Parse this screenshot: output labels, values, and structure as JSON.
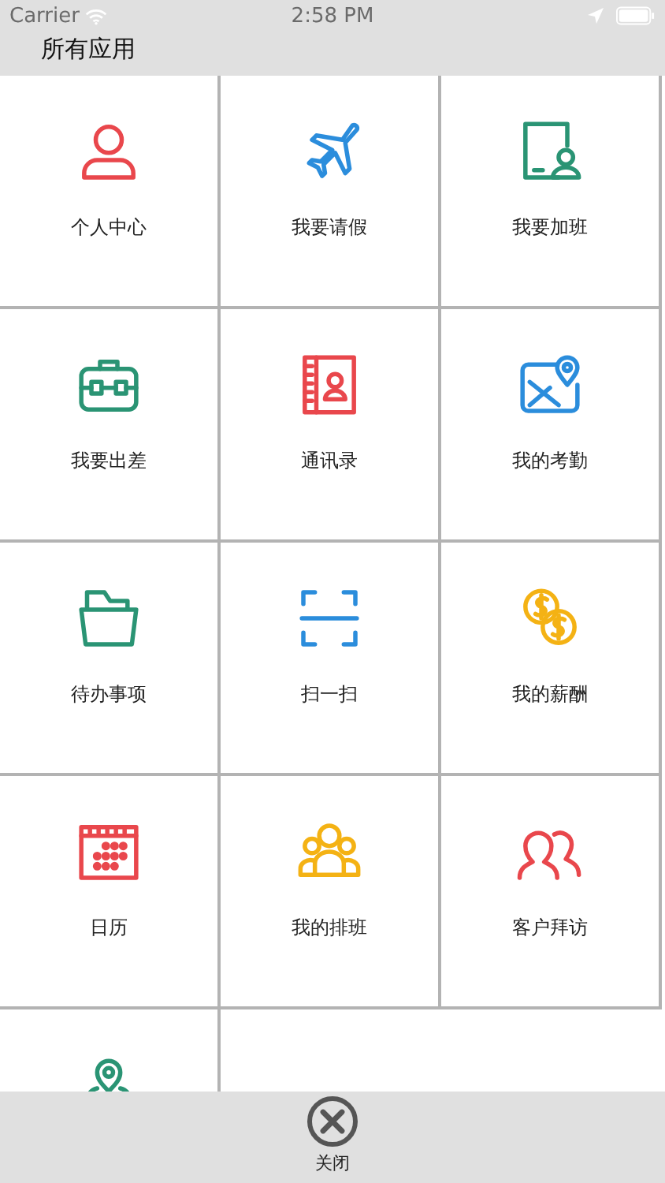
{
  "status_bar": {
    "carrier": "Carrier",
    "time": "2:58 PM"
  },
  "title": "所有应用",
  "apps": [
    {
      "label": "个人中心",
      "color": "#e9474c"
    },
    {
      "label": "我要请假",
      "color": "#2b8ddc"
    },
    {
      "label": "我要加班",
      "color": "#2a9474"
    },
    {
      "label": "我要出差",
      "color": "#2a9474"
    },
    {
      "label": "通讯录",
      "color": "#e9474c"
    },
    {
      "label": "我的考勤",
      "color": "#2b8ddc"
    },
    {
      "label": "待办事项",
      "color": "#2a9474"
    },
    {
      "label": "扫一扫",
      "color": "#2b8ddc"
    },
    {
      "label": "我的薪酬",
      "color": "#f4b214"
    },
    {
      "label": "日历",
      "color": "#e9474c"
    },
    {
      "label": "我的排班",
      "color": "#f4b214"
    },
    {
      "label": "客户拜访",
      "color": "#e9474c"
    },
    {
      "color": "#2a9474"
    }
  ],
  "close_button": {
    "label": "关闭"
  }
}
